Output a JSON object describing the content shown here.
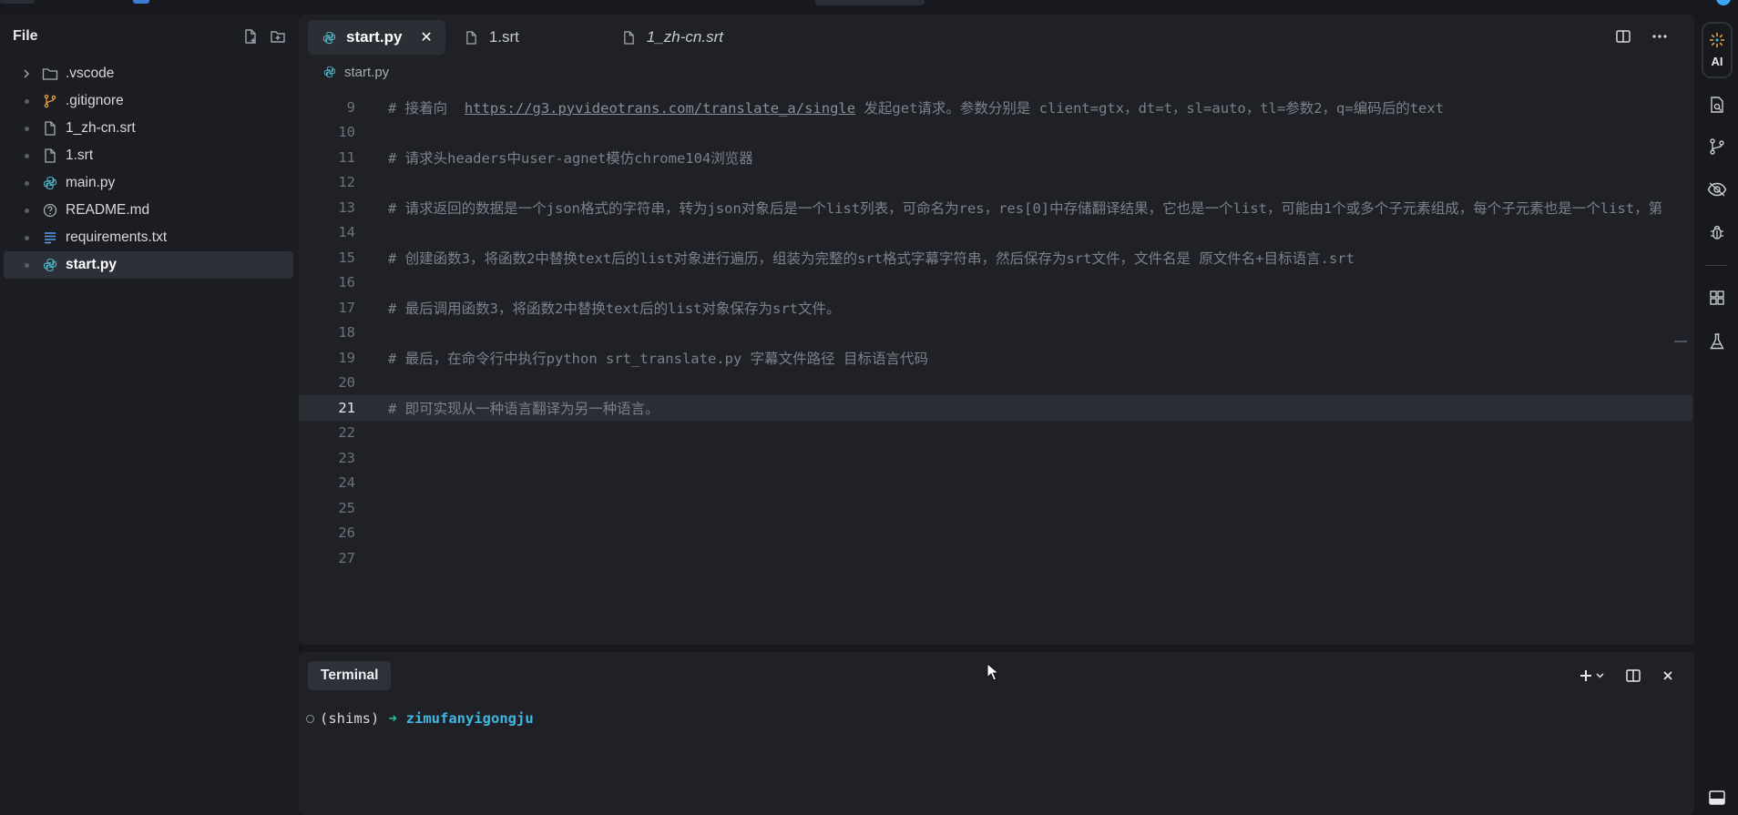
{
  "sidebar": {
    "title": "File",
    "items": [
      {
        "label": ".vscode",
        "kind": "folder",
        "icon": "folder-icon"
      },
      {
        "label": ".gitignore",
        "kind": "file",
        "icon": "git-branch-icon"
      },
      {
        "label": "1_zh-cn.srt",
        "kind": "file",
        "icon": "file-icon"
      },
      {
        "label": "1.srt",
        "kind": "file",
        "icon": "file-icon"
      },
      {
        "label": "main.py",
        "kind": "file",
        "icon": "python-icon"
      },
      {
        "label": "README.md",
        "kind": "file",
        "icon": "help-circle-icon"
      },
      {
        "label": "requirements.txt",
        "kind": "file",
        "icon": "text-lines-icon"
      },
      {
        "label": "start.py",
        "kind": "file",
        "icon": "python-icon",
        "active": true
      }
    ]
  },
  "tabs": [
    {
      "label": "start.py",
      "active": true,
      "icon": "python-icon"
    },
    {
      "label": "1.srt",
      "icon": "file-icon"
    },
    {
      "label": "1_zh-cn.srt",
      "italic": true,
      "icon": "file-icon"
    }
  ],
  "breadcrumb": "start.py",
  "code": [
    {
      "n": "9",
      "pre": "# 接着向  ",
      "url": "https://g3.pyvideotrans.com/translate_a/single",
      "post": " 发起get请求。参数分别是 client=gtx，dt=t，sl=auto，tl=参数2，q=编码后的text"
    },
    {
      "n": "10",
      "text": ""
    },
    {
      "n": "11",
      "text": "# 请求头headers中user-agnet模仿chrome104浏览器"
    },
    {
      "n": "12",
      "text": ""
    },
    {
      "n": "13",
      "text": "# 请求返回的数据是一个json格式的字符串，转为json对象后是一个list列表，可命名为res，res[0]中存储翻译结果，它也是一个list，可能由1个或多个子元素组成，每个子元素也是一个list，第"
    },
    {
      "n": "14",
      "text": ""
    },
    {
      "n": "15",
      "text": "# 创建函数3，将函数2中替换text后的list对象进行遍历，组装为完整的srt格式字幕字符串，然后保存为srt文件，文件名是 原文件名+目标语言.srt"
    },
    {
      "n": "16",
      "text": ""
    },
    {
      "n": "17",
      "text": "# 最后调用函数3，将函数2中替换text后的list对象保存为srt文件。"
    },
    {
      "n": "18",
      "text": ""
    },
    {
      "n": "19",
      "text": "# 最后，在命令行中执行python srt_translate.py 字幕文件路径 目标语言代码"
    },
    {
      "n": "20",
      "text": ""
    },
    {
      "n": "21",
      "text": "# 即可实现从一种语言翻译为另一种语言。",
      "current": true
    },
    {
      "n": "22",
      "text": ""
    },
    {
      "n": "23",
      "text": ""
    },
    {
      "n": "24",
      "text": ""
    },
    {
      "n": "25",
      "text": ""
    },
    {
      "n": "26",
      "text": ""
    },
    {
      "n": "27",
      "text": ""
    }
  ],
  "terminal": {
    "tab_label": "Terminal",
    "env": "(shims)",
    "arrow": "➜",
    "cwd": "zimufanyigongju"
  },
  "activity": {
    "ai_label": "AI"
  },
  "colors": {
    "accent_teal": "#2fc7a8",
    "accent_blue": "#3fb8e0",
    "git_orange": "#e0a040",
    "python_teal": "#4fb8c8"
  }
}
